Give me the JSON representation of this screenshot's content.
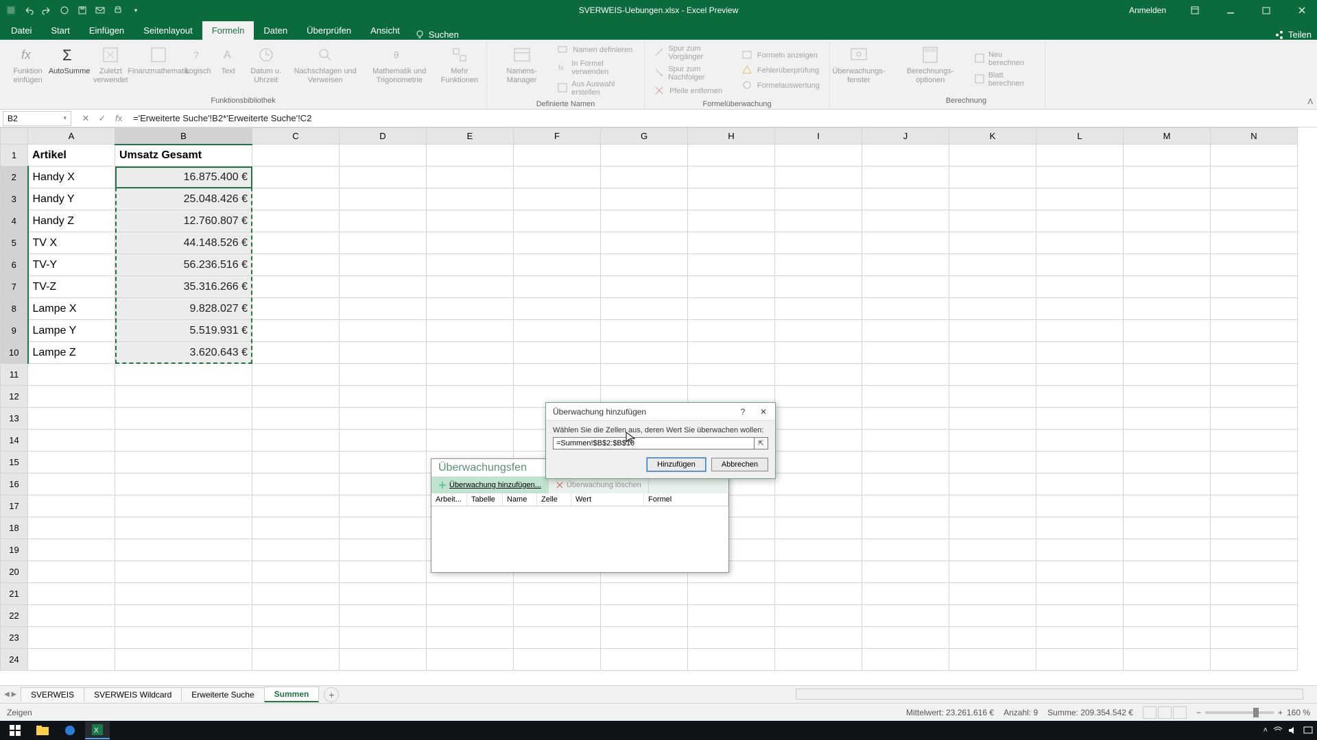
{
  "titlebar": {
    "title": "SVERWEIS-Uebungen.xlsx - Excel Preview",
    "login": "Anmelden"
  },
  "tabs": {
    "datei": "Datei",
    "start": "Start",
    "einfuegen": "Einfügen",
    "seitenlayout": "Seitenlayout",
    "formeln": "Formeln",
    "daten": "Daten",
    "ueberpruefen": "Überprüfen",
    "ansicht": "Ansicht",
    "suchen": "Suchen",
    "teilen": "Teilen"
  },
  "ribbon": {
    "funktion_einfuegen": "Funktion einfügen",
    "autosumme": "AutoSumme",
    "zuletzt": "Zuletzt verwendet",
    "finanz": "Finanzmathematik",
    "logisch": "Logisch",
    "text": "Text",
    "datum": "Datum u. Uhrzeit",
    "nachschlagen": "Nachschlagen und Verweisen",
    "math": "Mathematik und Trigonometrie",
    "mehr": "Mehr Funktionen",
    "bibliothek_label": "Funktionsbibliothek",
    "namens_manager": "Namens-Manager",
    "namen_def": "Namen definieren",
    "in_formel": "In Formel verwenden",
    "aus_auswahl": "Aus Auswahl erstellen",
    "def_namen_label": "Definierte Namen",
    "spur_vorg": "Spur zum Vorgänger",
    "spur_nach": "Spur zum Nachfolger",
    "pfeile": "Pfeile entfernen",
    "formeln_anz": "Formeln anzeigen",
    "fehler": "Fehlerüberprüfung",
    "formelausw": "Formelauswertung",
    "ueberwachung_label": "Formelüberwachung",
    "ueberwachungs_fenster": "Überwachungs-fenster",
    "berechnungs_opt": "Berechnungs-optionen",
    "neu_berechnen": "Neu berechnen",
    "blatt_berechnen": "Blatt berechnen",
    "berechnung_label": "Berechnung"
  },
  "formula_bar": {
    "name_box": "B2",
    "formula": "='Erweiterte Suche'!B2*'Erweiterte Suche'!C2"
  },
  "columns": [
    "A",
    "B",
    "C",
    "D",
    "E",
    "F",
    "G",
    "H",
    "I",
    "J",
    "K",
    "L",
    "M",
    "N"
  ],
  "headers": {
    "a": "Artikel",
    "b": "Umsatz Gesamt"
  },
  "rows": [
    {
      "a": "Handy X",
      "b": "16.875.400 €"
    },
    {
      "a": "Handy Y",
      "b": "25.048.426 €"
    },
    {
      "a": "Handy Z",
      "b": "12.760.807 €"
    },
    {
      "a": "TV X",
      "b": "44.148.526 €"
    },
    {
      "a": "TV-Y",
      "b": "56.236.516 €"
    },
    {
      "a": "TV-Z",
      "b": "35.316.266 €"
    },
    {
      "a": "Lampe X",
      "b": "9.828.027 €"
    },
    {
      "a": "Lampe Y",
      "b": "5.519.931 €"
    },
    {
      "a": "Lampe Z",
      "b": "3.620.643 €"
    }
  ],
  "watch": {
    "title": "Überwachungsfen",
    "add": "Überwachung hinzufügen...",
    "delete": "Überwachung löschen",
    "col_arbeit": "Arbeit...",
    "col_tabelle": "Tabelle",
    "col_name": "Name",
    "col_zelle": "Zelle",
    "col_wert": "Wert",
    "col_formel": "Formel"
  },
  "dialog": {
    "title": "Überwachung hinzufügen",
    "instr": "Wählen Sie die Zellen aus, deren Wert Sie überwachen wollen:",
    "ref": "=Summen!$B$2:$B$10",
    "ok": "Hinzufügen",
    "cancel": "Abbrechen"
  },
  "sheets": {
    "s1": "SVERWEIS",
    "s2": "SVERWEIS Wildcard",
    "s3": "Erweiterte Suche",
    "s4": "Summen"
  },
  "status": {
    "mode": "Zeigen",
    "mittelwert_label": "Mittelwert:",
    "mittelwert": "23.261.616 €",
    "anzahl_label": "Anzahl:",
    "anzahl": "9",
    "summe_label": "Summe:",
    "summe": "209.354.542 €",
    "zoom": "160 %"
  }
}
